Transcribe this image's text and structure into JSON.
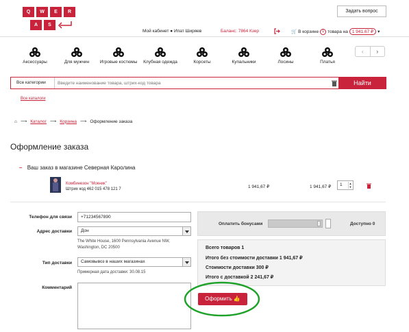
{
  "logo": {
    "letters": [
      "Q",
      "W",
      "E",
      "R",
      "A",
      "S"
    ]
  },
  "header": {
    "ask_button": "Задать вопрос",
    "cabinet_label": "Мой кабинет",
    "user_name": "Ипат Ширяев",
    "balance": "Баланс: 7864 Кзер",
    "cart_prefix": "В корзине",
    "cart_count": "1",
    "cart_middle": "товара на",
    "cart_total": "1 941,67 ₽"
  },
  "categories": [
    {
      "label": "Аксессуары"
    },
    {
      "label": "Для мужчин"
    },
    {
      "label": "Игровые костюмы"
    },
    {
      "label": "Клубная одежда"
    },
    {
      "label": "Корсеты"
    },
    {
      "label": "Купальники"
    },
    {
      "label": "Лосины"
    },
    {
      "label": "Платья"
    }
  ],
  "search": {
    "category": "Все категории",
    "placeholder": "Введите наименование товара, штрих-код товара",
    "button": "Найти",
    "all_link": "Все каталоги"
  },
  "breadcrumb": {
    "catalog": "Каталог",
    "cart": "Корзина",
    "current": "Оформление заказа"
  },
  "page_title": "Оформление заказа",
  "order": {
    "store_title": "Ваш заказ в магазине Северная Каролина",
    "item": {
      "name": "Комбинезон \"Мокник\"",
      "barcode": "Штрих код 462 015 478 121 7",
      "price": "1 941,67 ₽",
      "sum": "1 941,67 ₽",
      "qty": "1"
    }
  },
  "form": {
    "phone_label": "Телефон для связи",
    "phone_value": "+71234567890",
    "address_label": "Адрес доставки",
    "address_value": "Дон",
    "address_note_1": "The White House, 1600 Pennsylvania Avenue NW,",
    "address_note_2": "Washington, DC 20500",
    "delivery_label": "Тип доставки",
    "delivery_value": "Самовывоз в наших магазинах",
    "delivery_date": "Примерная дата доставки: 30.08.15",
    "comment_label": "Комментарий"
  },
  "bonus": {
    "label": "Оплатить бонусами",
    "available": "Доступно 0"
  },
  "summary": {
    "total_items": "Всего товаров 1",
    "without_delivery": "Итого без стоимости доставки 1 941,67 ₽",
    "delivery_cost": "Стоимости доставки 300 ₽",
    "with_delivery": "Итого с доставкой 2 241,67 ₽"
  },
  "submit_button": "Оформить",
  "colors": {
    "accent": "#c8233a",
    "highlight_circle": "#1fa22a"
  }
}
